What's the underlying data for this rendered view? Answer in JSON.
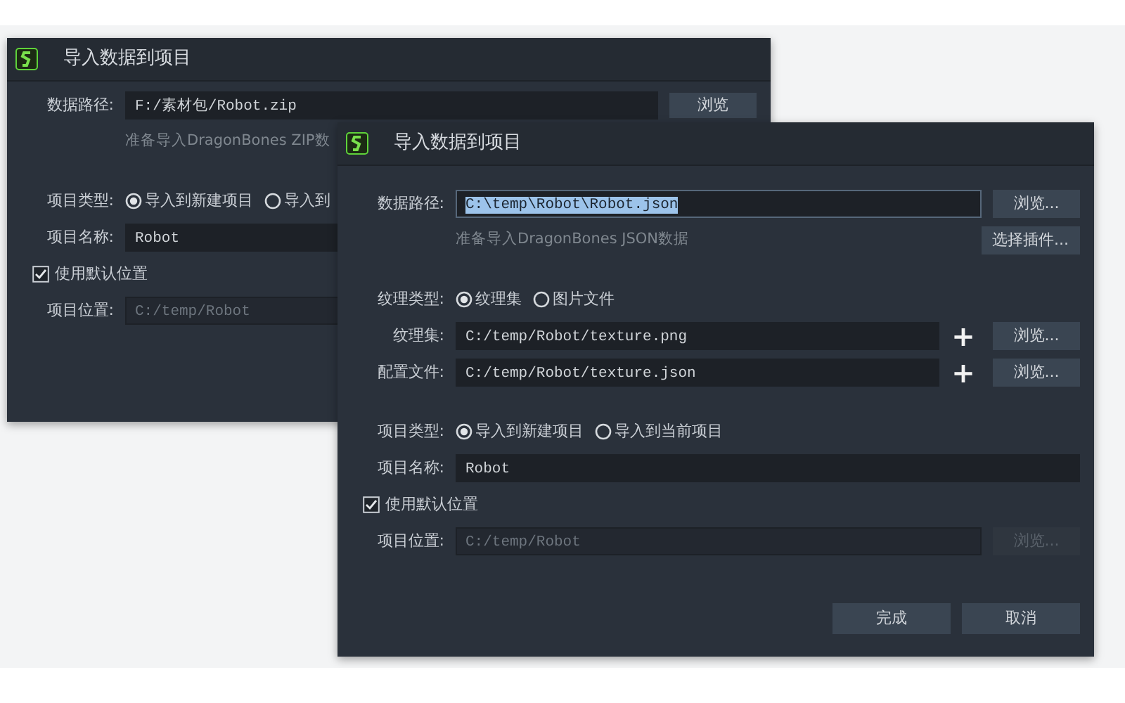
{
  "windows": [
    {
      "title": "导入数据到项目",
      "sections": [
        [
          {
            "kind": "field",
            "label": "数据路径:",
            "value": "F:/素材包/Robot.zip",
            "button": {
              "label": "浏览",
              "disabled": false
            }
          },
          {
            "kind": "hint",
            "text": "准备导入DragonBones ZIP数"
          }
        ],
        [
          {
            "kind": "radio",
            "label": "项目类型:",
            "options": [
              {
                "label": "导入到新建项目",
                "selected": true
              },
              {
                "label": "导入到",
                "selected": false
              }
            ]
          },
          {
            "kind": "field",
            "label": "项目名称:",
            "value": "Robot"
          },
          {
            "kind": "checkbox",
            "label": "使用默认位置",
            "checked": true
          },
          {
            "kind": "field",
            "label": "项目位置:",
            "value": "C:/temp/Robot",
            "disabled": true
          }
        ]
      ]
    },
    {
      "title": "导入数据到项目",
      "sections": [
        [
          {
            "kind": "field",
            "label": "数据路径:",
            "value": "C:\\temp\\Robot\\Robot.json",
            "text_selected": true,
            "button": {
              "label": "浏览...",
              "disabled": false
            }
          },
          {
            "kind": "hint",
            "text": "准备导入DragonBones JSON数据",
            "button": {
              "label": "选择插件...",
              "disabled": false
            }
          }
        ],
        [
          {
            "kind": "radio",
            "label": "纹理类型:",
            "options": [
              {
                "label": "纹理集",
                "selected": true
              },
              {
                "label": "图片文件",
                "selected": false
              }
            ]
          },
          {
            "kind": "field",
            "label": "纹理集:",
            "value": "C:/temp/Robot/texture.png",
            "plus": "+",
            "button": {
              "label": "浏览...",
              "disabled": false
            }
          },
          {
            "kind": "field",
            "label": "配置文件:",
            "value": "C:/temp/Robot/texture.json",
            "plus": "+",
            "button": {
              "label": "浏览...",
              "disabled": false
            }
          }
        ],
        [
          {
            "kind": "radio",
            "label": "项目类型:",
            "options": [
              {
                "label": "导入到新建项目",
                "selected": true
              },
              {
                "label": "导入到当前项目",
                "selected": false
              }
            ]
          },
          {
            "kind": "field",
            "label": "项目名称:",
            "value": "Robot"
          },
          {
            "kind": "checkbox",
            "label": "使用默认位置",
            "checked": true
          },
          {
            "kind": "field",
            "label": "项目位置:",
            "value": "C:/temp/Robot",
            "disabled": true,
            "button": {
              "label": "浏览...",
              "disabled": true
            }
          }
        ]
      ],
      "actions": [
        "完成",
        "取消"
      ]
    }
  ]
}
